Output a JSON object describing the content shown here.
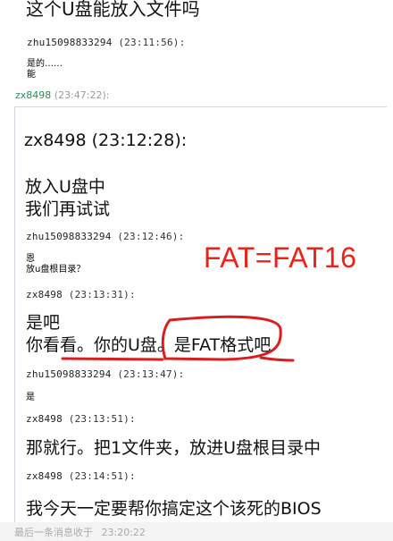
{
  "top_message": {
    "text": "这个U盘能放入文件吗"
  },
  "msg1": {
    "sender": "zhu15098833294",
    "time": "(23:11:56):",
    "lines": [
      "是的……",
      "能"
    ]
  },
  "outer_header": {
    "sender": "zx8498",
    "time": "(23:47:22):"
  },
  "quoted": {
    "header": "zx8498 (23:12:28):",
    "m1_lines": [
      "放入U盘中",
      "我们再试试"
    ],
    "m2": {
      "sender": "zhu15098833294",
      "time": "(23:12:46):",
      "lines": [
        "恩",
        "放u盘根目录？"
      ]
    },
    "m3": {
      "sender": "zx8498",
      "time": "(23:13:31):",
      "lines": [
        "是吧",
        "你看看。你的U盘。是FAT格式吧"
      ]
    },
    "m4": {
      "sender": "zhu15098833294",
      "time": "(23:13:47):",
      "lines": [
        "是"
      ]
    },
    "m5": {
      "sender": "zx8498",
      "time": "(23:13:51):",
      "lines": [
        "那就行。把1文件夹，放进U盘根目录中"
      ]
    },
    "m6": {
      "sender": "zx8498",
      "time": "(23:14:51):",
      "lines": [
        "我今天一定要帮你搞定这个该死的BIOS"
      ]
    }
  },
  "annotation": {
    "text": "FAT=FAT16",
    "color": "#e8231a"
  },
  "footer": {
    "label": "最后一条消息收于",
    "time": "23:20:22"
  }
}
